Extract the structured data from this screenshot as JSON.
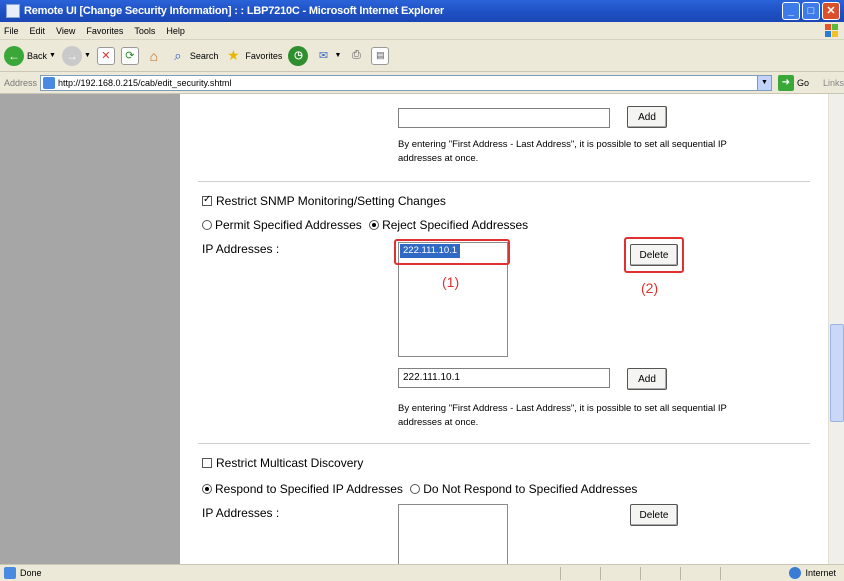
{
  "window": {
    "title": "Remote UI [Change Security Information] : : LBP7210C - Microsoft Internet Explorer",
    "controls": [
      "_",
      "□",
      "✕"
    ]
  },
  "menu": [
    "File",
    "Edit",
    "View",
    "Favorites",
    "Tools",
    "Help"
  ],
  "toolbar": {
    "back": "Back",
    "search": "Search",
    "favorites": "Favorites"
  },
  "address": {
    "label": "Address",
    "url": "http://192.168.0.215/cab/edit_security.shtml",
    "go": "Go",
    "links": "Links"
  },
  "page": {
    "top_add_button": "Add",
    "range_note_top_line1": "By entering \"First Address - Last Address\", it is possible to set all sequential IP",
    "range_note_top_line2": "addresses at once.",
    "snmp": {
      "restrict_label": "Restrict SNMP Monitoring/Setting Changes",
      "restrict_checked": true,
      "permit_label": "Permit Specified Addresses",
      "reject_label": "Reject Specified Addresses",
      "selected_mode": "reject",
      "ip_label": "IP Addresses :",
      "list_items": [
        "222.111.10.1"
      ],
      "delete_button": "Delete",
      "input_value": "222.111.10.1",
      "add_button": "Add",
      "range_note_line1": "By entering \"First Address - Last Address\", it is possible to set all sequential IP",
      "range_note_line2": "addresses at once.",
      "callout_1": "(1)",
      "callout_2": "(2)"
    },
    "multicast": {
      "restrict_label": "Restrict Multicast Discovery",
      "restrict_checked": false,
      "respond_label": "Respond to Specified IP Addresses",
      "not_respond_label": "Do Not Respond to Specified Addresses",
      "selected_mode": "respond",
      "ip_label": "IP Addresses :",
      "delete_button": "Delete"
    }
  },
  "status": {
    "text": "Done",
    "zone": "Internet"
  },
  "colors": {
    "titlebar": "#1e4fc2",
    "callout_red": "#e03030",
    "selection": "#316ac5",
    "left_panel": "#a6a6a6"
  }
}
